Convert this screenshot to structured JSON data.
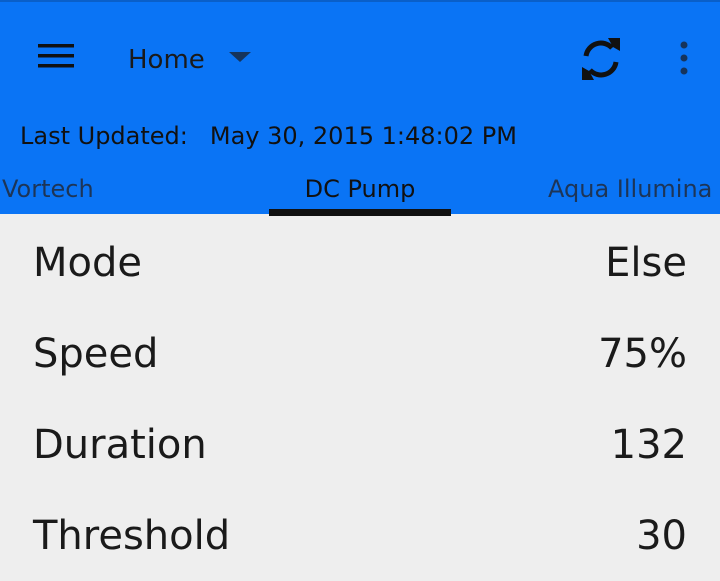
{
  "toolbar": {
    "nav_title": "Home",
    "icons": {
      "menu": "hamburger-menu-icon",
      "dropdown": "caret-down-icon",
      "refresh": "refresh-icon",
      "overflow": "overflow-menu-icon"
    }
  },
  "status": {
    "label": "Last Updated:",
    "timestamp": "May 30, 2015 1:48:02 PM"
  },
  "tabs": [
    {
      "label": "Vortech"
    },
    {
      "label": "DC Pump",
      "active": true
    },
    {
      "label": "Aqua Illumina"
    }
  ],
  "params": [
    {
      "label": "Mode",
      "value": "Else"
    },
    {
      "label": "Speed",
      "value": "75%"
    },
    {
      "label": "Duration",
      "value": "132"
    },
    {
      "label": "Threshold",
      "value": "30"
    }
  ],
  "colors": {
    "app_bar": "#0a74f5",
    "background": "#eeeeee",
    "tab_indicator": "#111111"
  }
}
